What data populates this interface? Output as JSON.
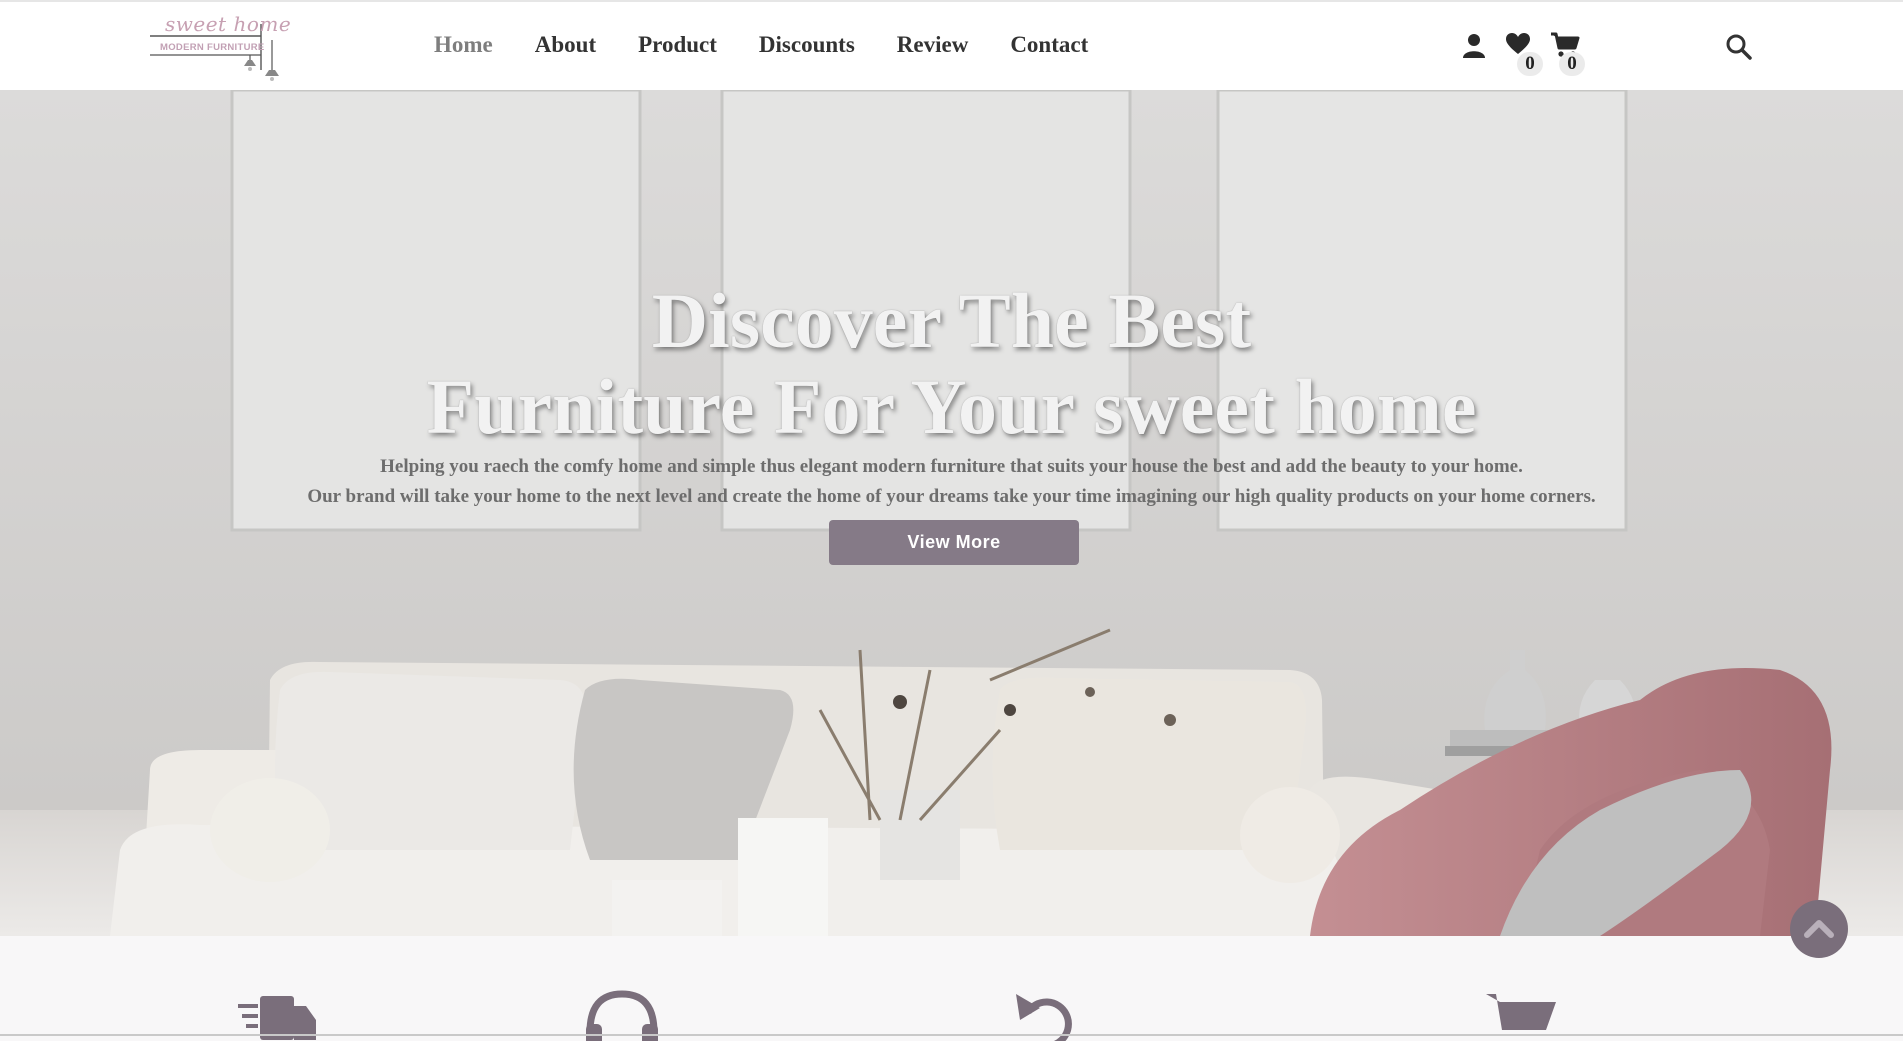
{
  "header": {
    "logo": {
      "script_text": "sweet home",
      "sub_text": "MODERN FURNITURE"
    },
    "nav": [
      {
        "label": "Home",
        "active": true
      },
      {
        "label": "About",
        "active": false
      },
      {
        "label": "Product",
        "active": false
      },
      {
        "label": "Discounts",
        "active": false
      },
      {
        "label": "Review",
        "active": false
      },
      {
        "label": "Contact",
        "active": false
      }
    ],
    "icons": {
      "user": "user-icon",
      "wishlist": "heart-icon",
      "cart": "cart-icon",
      "search": "search-icon"
    },
    "wishlist_count": "0",
    "cart_count": "0"
  },
  "hero": {
    "title_line1": "Discover The Best",
    "title_line2": "Furniture For Your sweet home",
    "desc_line1": "Helping you raech the comfy home and simple thus elegant modern furniture that suits your house the best and add the beauty to your home.",
    "desc_line2": "Our brand will take your home to the next level and create the home of your dreams take your time imagining our high quality products on your home corners.",
    "button_label": "View More"
  },
  "features": {
    "icons": [
      "truck-icon",
      "headset-icon",
      "undo-icon",
      "cart-icon"
    ]
  },
  "colors": {
    "accent": "#857a87",
    "logo_pink": "#c7a0b2",
    "nav_text": "#333333",
    "nav_active": "#7e7e7e"
  }
}
